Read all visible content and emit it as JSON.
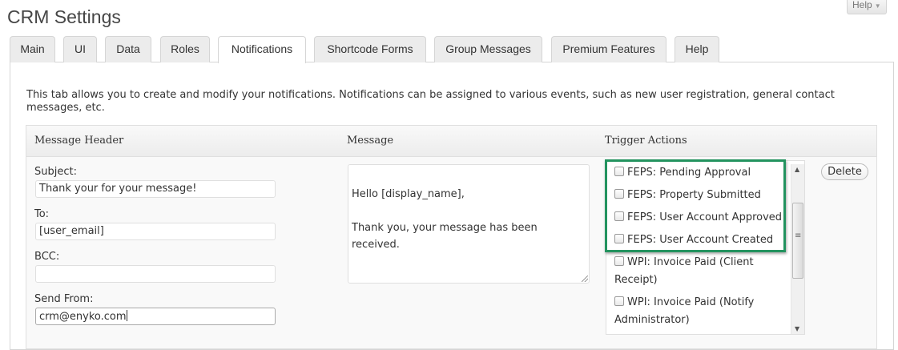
{
  "page": {
    "title": "CRM Settings",
    "help_label": "Help"
  },
  "tabs": [
    {
      "label": "Main"
    },
    {
      "label": "UI"
    },
    {
      "label": "Data"
    },
    {
      "label": "Roles"
    },
    {
      "label": "Notifications",
      "active": true
    },
    {
      "label": "Shortcode Forms"
    },
    {
      "label": "Group Messages"
    },
    {
      "label": "Premium Features"
    },
    {
      "label": "Help"
    }
  ],
  "intro_text": "This tab allows you to create and modify your notifications. Notifications can be assigned to various events, such as new user registration, general contact messages, etc.",
  "table": {
    "headers": {
      "message_header": "Message Header",
      "message": "Message",
      "trigger_actions": "Trigger Actions"
    },
    "row": {
      "subject_label": "Subject:",
      "subject_value": "Thank your for your message!",
      "to_label": "To:",
      "to_value": "[user_email]",
      "bcc_label": "BCC:",
      "bcc_value": "",
      "send_from_label": "Send From:",
      "send_from_value": "crm@enyko.com",
      "message_line1": "Hello [display_name],",
      "message_line2": "Thank you, your message has been received.",
      "triggers": [
        {
          "label": "FEPS: Pending Approval",
          "checked": false
        },
        {
          "label": "FEPS: Property Submitted",
          "checked": false
        },
        {
          "label": "FEPS: User Account Approved",
          "checked": false
        },
        {
          "label": "FEPS: User Account Created",
          "checked": false
        },
        {
          "label": "WPI: Invoice Paid (Client Receipt)",
          "checked": false
        },
        {
          "label": "WPI: Invoice Paid (Notify Administrator)",
          "checked": false
        }
      ],
      "delete_label": "Delete"
    }
  },
  "colors": {
    "highlight": "#23935f"
  }
}
